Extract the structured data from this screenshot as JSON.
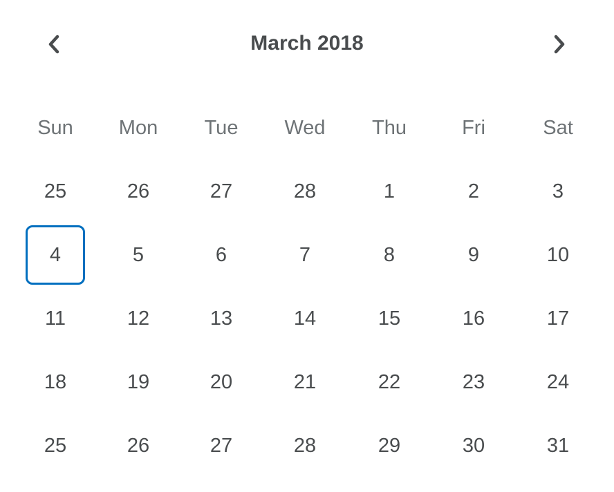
{
  "header": {
    "title": "March 2018",
    "prev_icon": "chevron-left-icon",
    "next_icon": "chevron-right-icon"
  },
  "weekdays": [
    "Sun",
    "Mon",
    "Tue",
    "Wed",
    "Thu",
    "Fri",
    "Sat"
  ],
  "weeks": [
    [
      "25",
      "26",
      "27",
      "28",
      "1",
      "2",
      "3"
    ],
    [
      "4",
      "5",
      "6",
      "7",
      "8",
      "9",
      "10"
    ],
    [
      "11",
      "12",
      "13",
      "14",
      "15",
      "16",
      "17"
    ],
    [
      "18",
      "19",
      "20",
      "21",
      "22",
      "23",
      "24"
    ],
    [
      "25",
      "26",
      "27",
      "28",
      "29",
      "30",
      "31"
    ]
  ],
  "selected": {
    "week": 1,
    "day": 0,
    "label": "4"
  },
  "colors": {
    "text": "#494c4e",
    "weekday_text": "#6e7376",
    "focus_ring": "#006fbf"
  }
}
